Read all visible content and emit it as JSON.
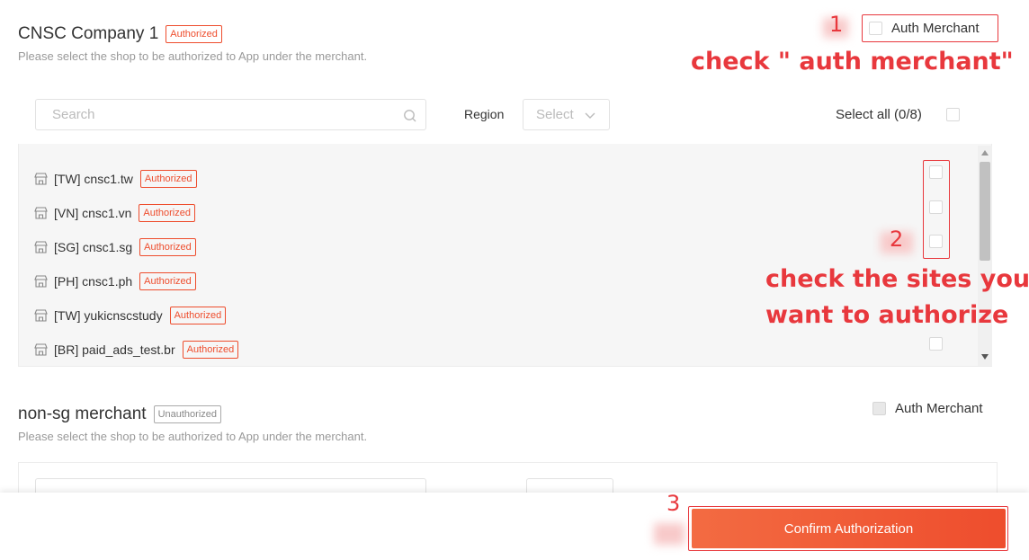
{
  "merchant1": {
    "name": "CNSC Company 1",
    "status": "Authorized",
    "description": "Please select the shop to be authorized to App under the merchant.",
    "auth_label": "Auth Merchant",
    "search_placeholder": "Search",
    "region_label": "Region",
    "region_select": "Select",
    "select_all": "Select all (0/8)",
    "shops": [
      {
        "name": "[TW] cnsc1.tw",
        "status": "Authorized"
      },
      {
        "name": "[VN] cnsc1.vn",
        "status": "Authorized"
      },
      {
        "name": "[SG] cnsc1.sg",
        "status": "Authorized"
      },
      {
        "name": "[PH] cnsc1.ph",
        "status": "Authorized"
      },
      {
        "name": "[TW] yukicnscstudy",
        "status": "Authorized"
      },
      {
        "name": "[BR] paid_ads_test.br",
        "status": "Authorized"
      }
    ]
  },
  "merchant2": {
    "name": "non-sg merchant",
    "status": "Unauthorized",
    "description": "Please select the shop to be authorized to App under the merchant.",
    "auth_label": "Auth Merchant"
  },
  "footer": {
    "confirm_label": "Confirm Authorization"
  },
  "annotations": {
    "step1_number": "1",
    "step1_note": "check \" auth merchant\"",
    "step2_number": "2",
    "step2_note_line1": "check the sites you",
    "step2_note_line2": "want to authorize",
    "step3_number": "3"
  },
  "colors": {
    "accent": "#ee4d2d",
    "annotation_red": "#e8383d"
  }
}
